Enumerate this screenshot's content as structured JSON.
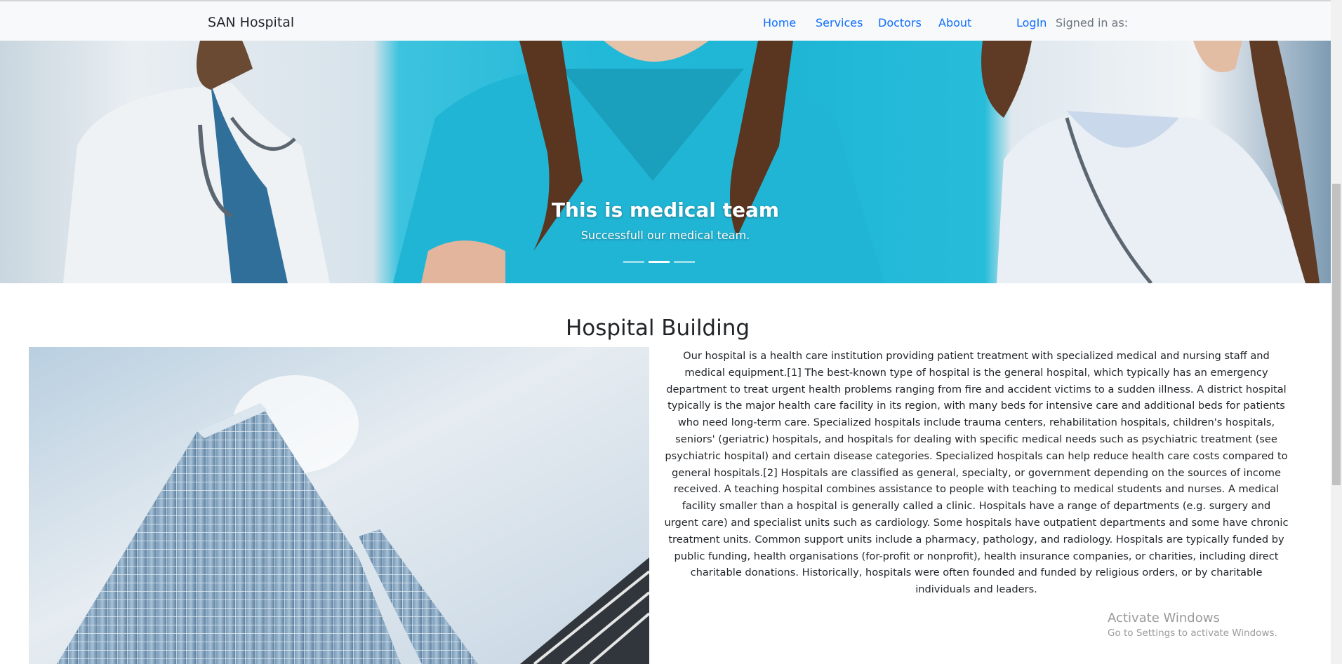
{
  "navbar": {
    "brand": "SAN Hospital",
    "links": [
      {
        "label": "Home"
      },
      {
        "label": "Services"
      },
      {
        "label": "Doctors"
      },
      {
        "label": "About"
      }
    ],
    "login": "LogIn",
    "signed_in": "Signed in as:"
  },
  "hero": {
    "title": "This is medical team",
    "subtitle": "Successfull our medical team.",
    "slide_count": 3,
    "active_slide": 2
  },
  "section": {
    "title": "Hospital Building",
    "paragraph": "Our hospital is a health care institution providing patient treatment with specialized medical and nursing staff and medical equipment.[1] The best-known type of hospital is the general hospital, which typically has an emergency department to treat urgent health problems ranging from fire and accident victims to a sudden illness. A district hospital typically is the major health care facility in its region, with many beds for intensive care and additional beds for patients who need long-term care. Specialized hospitals include trauma centers, rehabilitation hospitals, children's hospitals, seniors' (geriatric) hospitals, and hospitals for dealing with specific medical needs such as psychiatric treatment (see psychiatric hospital) and certain disease categories. Specialized hospitals can help reduce health care costs compared to general hospitals.[2] Hospitals are classified as general, specialty, or government depending on the sources of income received. A teaching hospital combines assistance to people with teaching to medical students and nurses. A medical facility smaller than a hospital is generally called a clinic. Hospitals have a range of departments (e.g. surgery and urgent care) and specialist units such as cardiology. Some hospitals have outpatient departments and some have chronic treatment units. Common support units include a pharmacy, pathology, and radiology. Hospitals are typically funded by public funding, health organisations (for-profit or nonprofit), health insurance companies, or charities, including direct charitable donations. Historically, hospitals were often founded and funded by religious orders, or by charitable individuals and leaders."
  },
  "watermark": {
    "line1": "Activate Windows",
    "line2": "Go to Settings to activate Windows."
  },
  "colors": {
    "link": "#0d6efd",
    "navbar_bg": "#f8f9fa",
    "scrub_teal": "#1fb6d6"
  }
}
